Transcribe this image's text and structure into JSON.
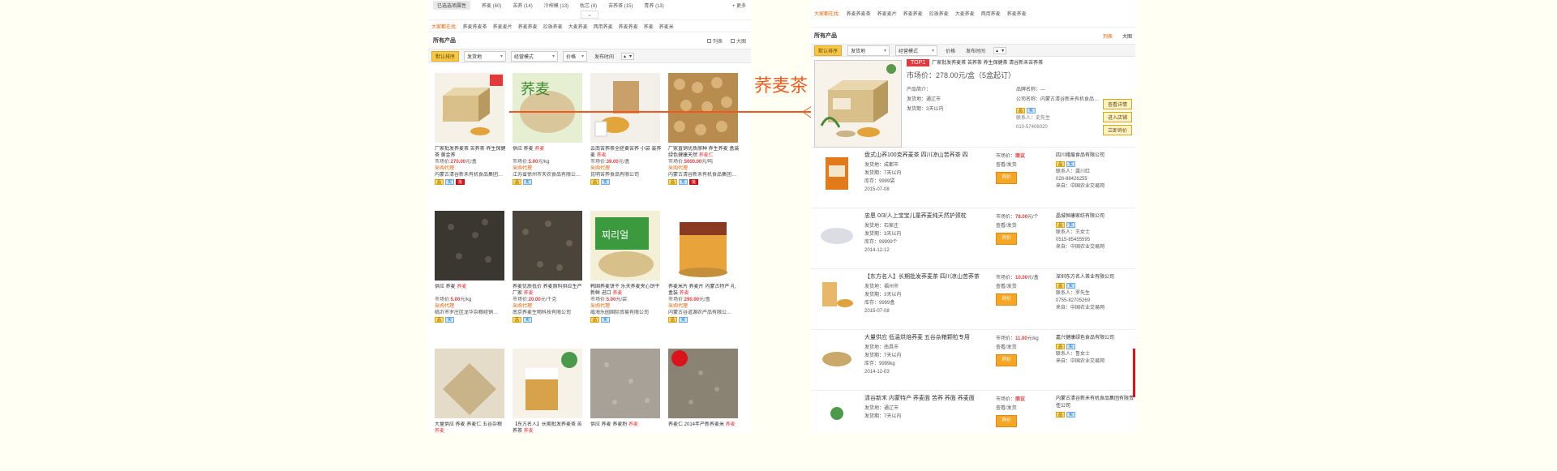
{
  "left": {
    "selected_filters_label": "已选选项属性",
    "filters": [
      "荞麦 (60)",
      "苦荞 (14)",
      "冷榨模 (13)",
      "枕芯 (4)",
      "苦荞茶 (15)",
      "青荞 (13)",
      "(13)"
    ],
    "more_label": "更多",
    "hotsearch_label": "大家都在找:",
    "hotsearch": [
      "荞麦荞麦茶",
      "荞麦麦片",
      "荞麦荞麦",
      "珍珠荞麦",
      "大麦荞麦",
      "两用荞麦",
      "荞麦荞麦",
      "荞麦",
      "荞麦米"
    ],
    "section_title": "所有产品",
    "view_list": "列表",
    "view_big": "大图",
    "sort_default": "默认排序",
    "sort_location": "发货地",
    "sort_mode": "经营模式",
    "sort_price": "价格",
    "sort_time": "发布时间",
    "products": [
      {
        "t1": "厂家批发荞麦茶 苦荞茶 养生保健茶 黄金荞",
        "t2": "",
        "price": "270.00",
        "unit": "元/盒",
        "link": "采购代理",
        "comp": "内蒙古清谷新禾有机食品集团…",
        "badges": [
          "品",
          "实",
          "批"
        ]
      },
      {
        "t1": "供应 荞麦",
        "t2": "荞麦",
        "price": "5.00",
        "unit": "元/kg",
        "link": "采购代理",
        "comp": "江苏省徐州市天农食品有限公…",
        "badges": [
          "品",
          "实"
        ]
      },
      {
        "t1": "云南苦荞茶全胚黄苦荞 小袋 装荞麦",
        "t2": "荞麦",
        "price": "39.00",
        "unit": "元/盒",
        "link": "采购代理",
        "comp": "昆明苦荞食品有限公司",
        "badges": [
          "品",
          "实"
        ]
      },
      {
        "t1": "厂家直销优质原种 养生荞麦 盒装绿色健康天然",
        "t2": "荞麦仁",
        "price": "5000.00",
        "unit": "元/吨",
        "link": "采购代理",
        "comp": "内蒙古清谷新禾有机食品集团…",
        "badges": [
          "品",
          "实",
          "批"
        ]
      },
      {
        "t1": "供应 荞麦",
        "t2": "荞麦",
        "price": "5.00",
        "unit": "元/kg",
        "link": "采购代理",
        "comp": "临沂市罗庄区龙华杂粮经销…",
        "badges": [
          "品",
          "实"
        ]
      },
      {
        "t1": "荞麦优质低价 荞麦原料供应生产厂家",
        "t2": "荞麦",
        "price": "20.00",
        "unit": "元/千克",
        "link": "采购代理",
        "comp": "南京荞麦生物科技有限公司",
        "badges": [
          "品",
          "实"
        ]
      },
      {
        "t1": "韩国荞麦饼干 乐天荞麦夹心饼干 新鲜 进口",
        "t2": "荞麦",
        "price": "5.00",
        "unit": "元/袋",
        "link": "采购代理",
        "comp": "威海乐园国际贸易有限公司",
        "badges": [
          "品",
          "实"
        ]
      },
      {
        "t1": "荞麦米片 荞麦片 内蒙古特产 礼盒装",
        "t2": "荞麦",
        "price": "290.00",
        "unit": "元/盒",
        "link": "采购代理",
        "comp": "内蒙古谷道源农产品有限公…",
        "badges": [
          "品",
          "实"
        ]
      },
      {
        "t1": "大量供应 荞麦 荞麦仁 五谷杂粮",
        "t2": "荞麦",
        "price": "",
        "unit": "",
        "link": "",
        "comp": "",
        "badges": []
      },
      {
        "t1": "【东方名人】长期批发荞麦茶 苦荞茶",
        "t2": "荞麦",
        "price": "",
        "unit": "",
        "link": "",
        "comp": "",
        "badges": []
      },
      {
        "t1": "供应 荞麦 荞麦粉",
        "t2": "荞麦",
        "price": "",
        "unit": "",
        "link": "",
        "comp": "",
        "badges": []
      },
      {
        "t1": "荞麦仁 2014年产新荞麦米",
        "t2": "荞麦",
        "price": "",
        "unit": "",
        "link": "",
        "comp": "",
        "badges": []
      }
    ],
    "price_prefix": "市场价:"
  },
  "annotation": {
    "label": "荞麦茶",
    "color": "#f0581f"
  },
  "right": {
    "hotsearch_label": "大家都在找:",
    "hotsearch": [
      "荞麦荞麦茶",
      "荞麦麦片",
      "荞麦荞麦",
      "珍珠荞麦",
      "大麦荞麦",
      "两用荞麦",
      "荞麦荞麦"
    ],
    "section_title": "所有产品",
    "view_list": "列表",
    "view_big": "大图",
    "sort_default": "默认排序",
    "sort_location": "发货地",
    "sort_mode": "经营模式",
    "sort_price": "价格",
    "sort_time": "发布时间",
    "featured": {
      "badge": "TOP1",
      "title": "厂家批发荞麦茶 苦荞茶 养生保健茶 清谷新禾苦荞茶",
      "price": "市场价：278.00元/盒（5盒起订）",
      "origin": "产品简介：",
      "ship_from": "发货地：通辽市",
      "ship_time": "发货期：3天以内",
      "brand": "品牌名称：---",
      "company": "公司名称：内蒙古清谷新禾有机食品…",
      "contact1": "联系人：史先生",
      "contact2": "010-57406020",
      "btn_inquiry": "查看详情",
      "btn_shop": "进入店铺",
      "btn_buy": "立即询价"
    },
    "rows": [
      {
        "title": "盘式山荞100克荞麦茶  四川凉山苦荞茶 四",
        "ship": "发货地：成都市",
        "time": "发货期：7天以内",
        "stock": "库存：9999袋",
        "date": "2015-07-08",
        "price_label": "市场价：",
        "price": "面议",
        "detail": "查看/发货",
        "btn": "询价",
        "comp": "四川峨眉食品有限公司",
        "contact": "联系人：龚川红",
        "phone": "028-88426255",
        "source": "来自：中国农业交易网"
      },
      {
        "title": "忠恩 0/3/人上宝宝儿童荞麦纯天然护颈枕",
        "ship": "发货地：石家庄",
        "time": "发货期：3天以内",
        "stock": "库存：99999个",
        "date": "2014-12-12",
        "price_label": "市场价：",
        "price": "78.00",
        "unit": "元/个",
        "detail": "查看/发货",
        "btn": "询价",
        "comp": "晶城恒康家纺有限公司",
        "contact": "联系人：王女士",
        "phone": "0515-85455595",
        "source": "来自：中国农业交易网"
      },
      {
        "title": "【东方名人】长期批发荞麦茶 四川凉山苦荞茶",
        "ship": "发货地：福州市",
        "time": "发货期：3天以内",
        "stock": "库存：9999盒",
        "date": "2015-07-08",
        "price_label": "市场价：",
        "price": "10.00",
        "unit": "元/盒",
        "detail": "查看/发货",
        "btn": "询价",
        "comp": "深圳东方名人茶业有限公司",
        "contact": "联系人：罗先生",
        "phone": "0755-82705269",
        "source": "来自：中国农业交易网"
      },
      {
        "title": "大量供应 低温烘焙荞麦 五谷杂粮颗粒专用",
        "ship": "发货地：南昌市",
        "time": "发货期：7天以内",
        "stock": "库存：9999kg",
        "date": "2014-12-03",
        "price_label": "市场价：",
        "price": "11.00",
        "unit": "元/kg",
        "detail": "查看/发货",
        "btn": "询价",
        "comp": "嘉兴健康绿色食品有限公司",
        "contact": "联系人：鲁女士",
        "phone": "",
        "source": "来自：中国农业交易网"
      },
      {
        "title": "清谷新禾 内蒙特产 荞麦面 苦荞 荞面 荞麦面",
        "ship": "发货地：通辽市",
        "time": "发货期：7天以内",
        "stock": "",
        "date": "",
        "price_label": "市场价：",
        "price": "面议",
        "detail": "查看/发货",
        "btn": "询价",
        "comp": "内蒙古清谷新禾有机食品集团有限责任公司",
        "contact": "",
        "phone": "",
        "source": ""
      }
    ]
  }
}
